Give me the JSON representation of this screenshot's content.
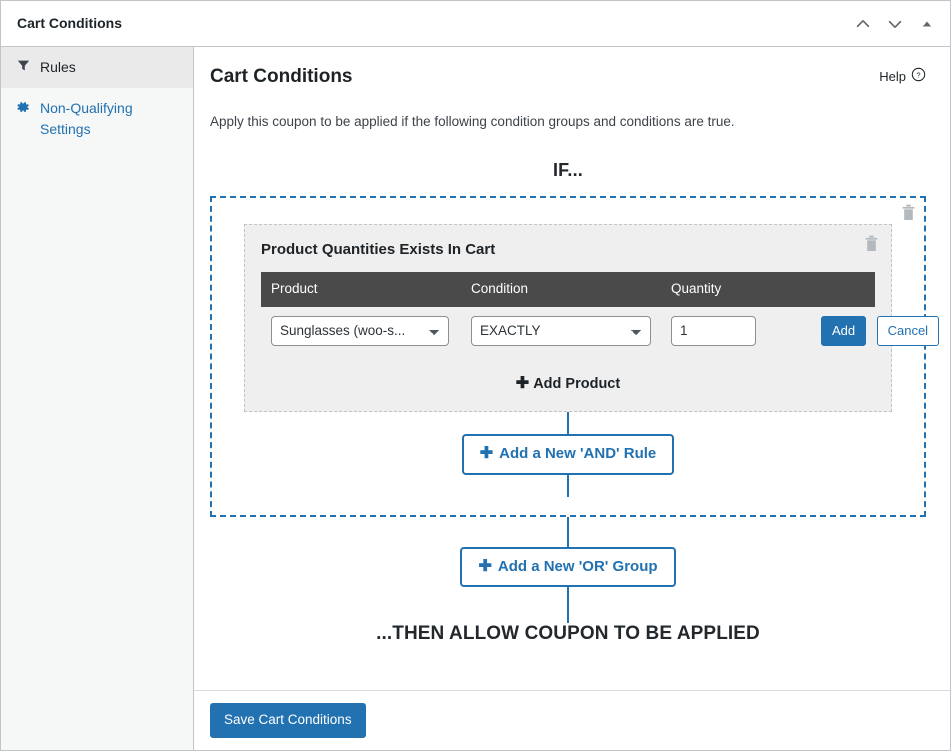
{
  "window": {
    "title": "Cart Conditions",
    "actions": [
      {
        "name": "move-up",
        "icon": "chevron-up-icon"
      },
      {
        "name": "move-down",
        "icon": "chevron-down-icon"
      },
      {
        "name": "toggle-panel",
        "icon": "triangle-up-icon"
      }
    ]
  },
  "sidebar": {
    "items": [
      {
        "label": "Rules",
        "icon": "funnel-icon",
        "active": true
      },
      {
        "label": "Non-Qualifying Settings",
        "icon": "gear-icon",
        "active": false
      }
    ]
  },
  "main": {
    "title": "Cart Conditions",
    "help_label": "Help",
    "help_icon": "question-circle-icon",
    "description": "Apply this coupon to be applied if the following condition groups and conditions are true.",
    "if_label": "IF...",
    "then_label": "...THEN ALLOW COUPON TO BE APPLIED",
    "add_and_rule_label": "Add a New 'AND' Rule",
    "add_or_group_label": "Add a New 'OR' Group",
    "plus_glyph": "✚",
    "group": {
      "delete_icon": "trash-icon",
      "card": {
        "title": "Product Quantities Exists In Cart",
        "delete_icon": "trash-icon",
        "columns": [
          "Product",
          "Condition",
          "Quantity",
          ""
        ],
        "row": {
          "product_value": "Sunglasses (woo-s...",
          "condition_value": "EXACTLY",
          "quantity_value": "1",
          "quantity_placeholder": "",
          "add_label": "Add",
          "cancel_label": "Cancel"
        },
        "add_product_label": "Add Product"
      }
    }
  },
  "footer": {
    "save_label": "Save Cart Conditions"
  },
  "colors": {
    "accent": "#2271b1",
    "table_header_bg": "#4a4a4a",
    "card_bg": "#efefef",
    "sidebar_bg": "#f6f7f7"
  }
}
